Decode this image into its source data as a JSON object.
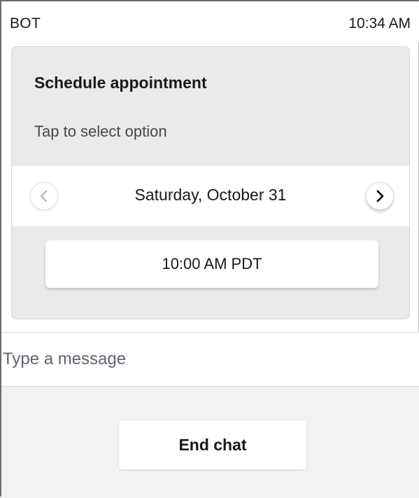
{
  "header": {
    "sender": "BOT",
    "timestamp": "10:34 AM"
  },
  "card": {
    "title": "Schedule appointment",
    "subtitle": "Tap to select option",
    "date_navigator": {
      "date": "Saturday, October 31",
      "prev_icon": "chevron-left-icon",
      "next_icon": "chevron-right-icon"
    },
    "time_options": [
      "10:00 AM PDT"
    ]
  },
  "composer": {
    "value": "",
    "placeholder": "Type a message"
  },
  "footer": {
    "end_chat_label": "End chat"
  },
  "colors": {
    "card_background": "#eaeaea",
    "footer_background": "#f2f2f2",
    "text": "#16191f"
  }
}
